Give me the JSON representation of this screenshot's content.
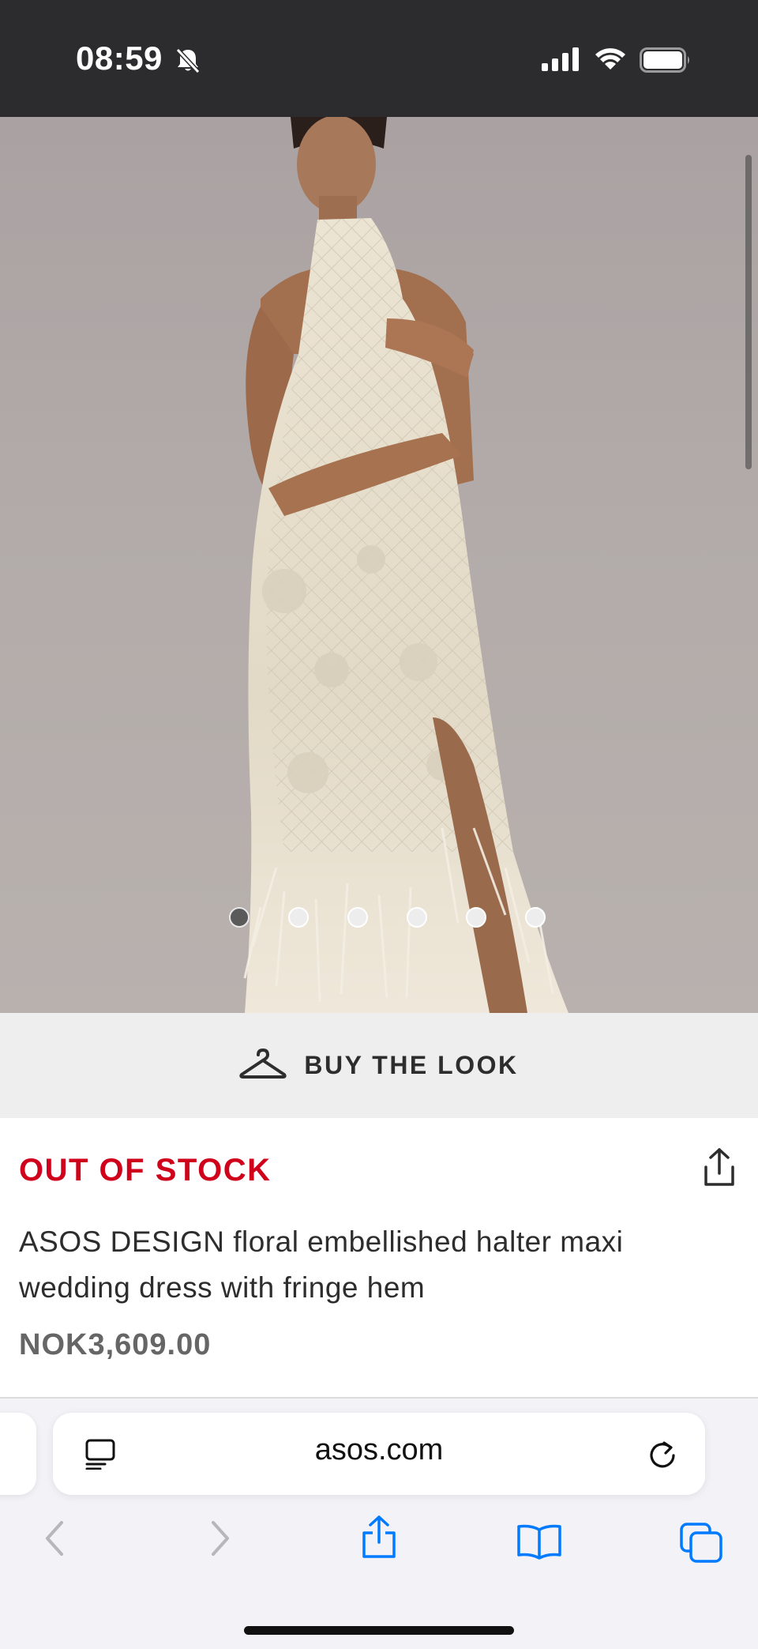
{
  "status_bar": {
    "time": "08:59",
    "silent_icon": "bell-slash-icon",
    "signal_icon": "cellular-signal-icon",
    "wifi_icon": "wifi-icon",
    "battery_icon": "battery-full-icon"
  },
  "product_gallery": {
    "image_alt": "Model wearing floral embellished halter maxi wedding dress with feather fringe hem",
    "total_images": 6,
    "active_index": 0
  },
  "buy_the_look": {
    "icon": "hanger-icon",
    "label": "BUY THE LOOK"
  },
  "product": {
    "stock_status": "OUT OF STOCK",
    "title": "ASOS DESIGN floral embellished halter maxi wedding dress with fringe hem",
    "price": "NOK3,609.00",
    "share_icon": "share-icon"
  },
  "browser": {
    "url": "asos.com",
    "reader_icon": "reader-mode-icon",
    "reload_icon": "reload-icon",
    "toolbar": [
      "back-icon",
      "forward-icon",
      "share-icon",
      "bookmarks-icon",
      "tabs-icon"
    ]
  },
  "colors": {
    "accent_red": "#d0021b",
    "ios_blue": "#007aff",
    "status_bar_bg": "#2c2c2e"
  }
}
